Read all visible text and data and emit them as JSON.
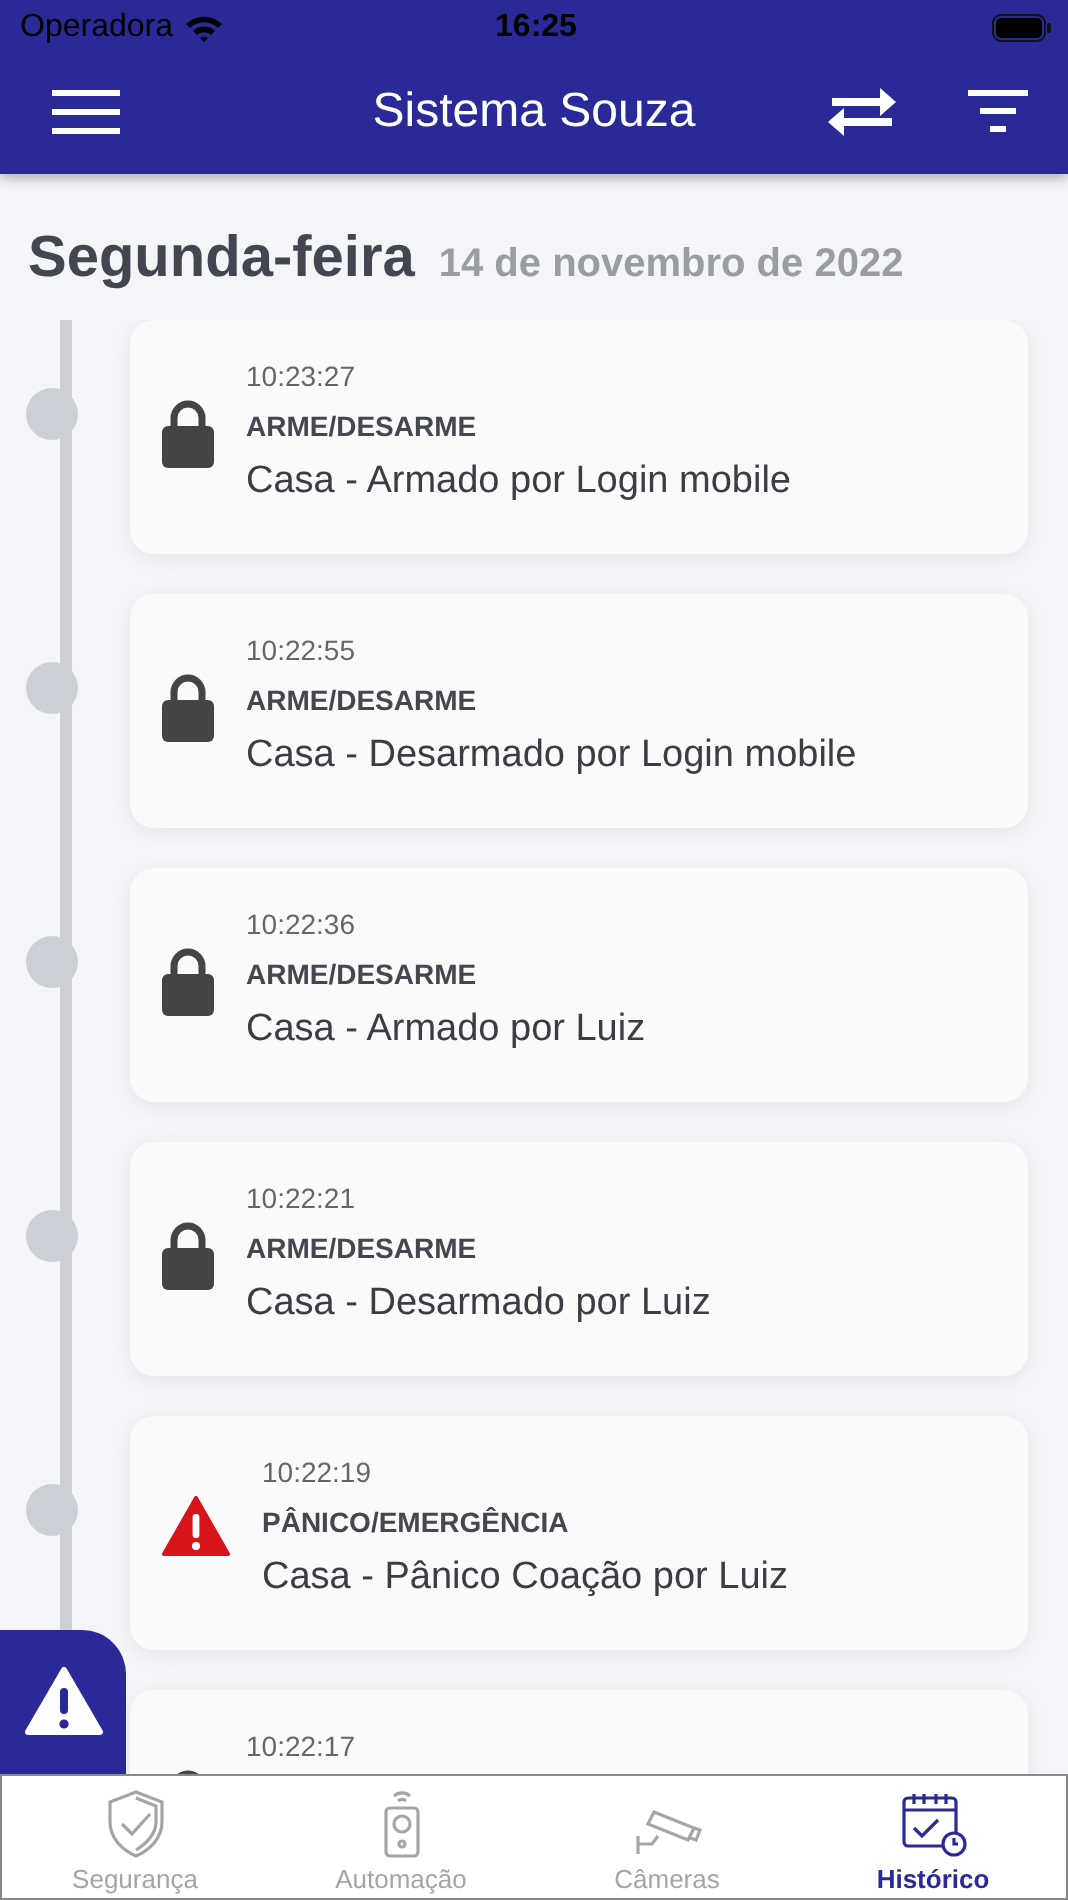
{
  "status_bar": {
    "carrier": "Operadora",
    "time": "16:25"
  },
  "nav": {
    "title": "Sistema Souza"
  },
  "day": {
    "weekday": "Segunda-feira",
    "date": "14 de novembro de 2022"
  },
  "events": [
    {
      "kind": "lock",
      "time": "10:23:27",
      "category": "ARME/DESARME",
      "description": "Casa - Armado por Login mobile"
    },
    {
      "kind": "lock",
      "time": "10:22:55",
      "category": "ARME/DESARME",
      "description": "Casa - Desarmado por Login mobile"
    },
    {
      "kind": "lock",
      "time": "10:22:36",
      "category": "ARME/DESARME",
      "description": "Casa - Armado por Luiz"
    },
    {
      "kind": "lock",
      "time": "10:22:21",
      "category": "ARME/DESARME",
      "description": "Casa - Desarmado por Luiz"
    },
    {
      "kind": "alert",
      "time": "10:22:19",
      "category": "PÂNICO/EMERGÊNCIA",
      "description": "Casa - Pânico Coação por Luiz"
    },
    {
      "kind": "lock",
      "time": "10:22:17"
    }
  ],
  "tabs": [
    {
      "kind": "shield",
      "label": "Segurança",
      "selected": false
    },
    {
      "kind": "remote",
      "label": "Automação",
      "selected": false
    },
    {
      "kind": "camera",
      "label": "Câmeras",
      "selected": false
    },
    {
      "kind": "calendar",
      "label": "Histórico",
      "selected": true
    }
  ]
}
